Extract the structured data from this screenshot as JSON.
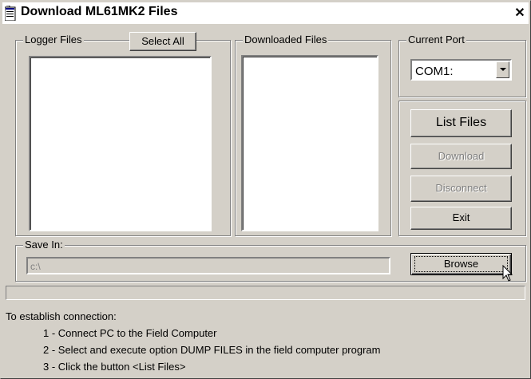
{
  "window": {
    "title": "Download ML61MK2 Files",
    "close_glyph": "✕"
  },
  "logger_files": {
    "group_label": "Logger Files",
    "select_all_label": "Select All"
  },
  "downloaded_files": {
    "group_label": "Downloaded Files"
  },
  "current_port": {
    "group_label": "Current Port",
    "selected": "COM1:"
  },
  "actions": {
    "list_files": "List Files",
    "download": "Download",
    "disconnect": "Disconnect",
    "exit": "Exit"
  },
  "save_in": {
    "group_label": "Save In:",
    "path": "c:\\",
    "browse_label": "Browse"
  },
  "progress": {
    "value": 0
  },
  "instructions": {
    "heading": "To establish connection:",
    "steps": [
      "1  -  Connect PC to the Field Computer",
      "2  -  Select and execute option DUMP FILES in the field computer program",
      "3  -  Click the button <List Files>"
    ]
  },
  "icons": {
    "app": "app-window-icon",
    "dropdown": "chevron-down-icon",
    "cursor": "mouse-pointer-icon"
  }
}
